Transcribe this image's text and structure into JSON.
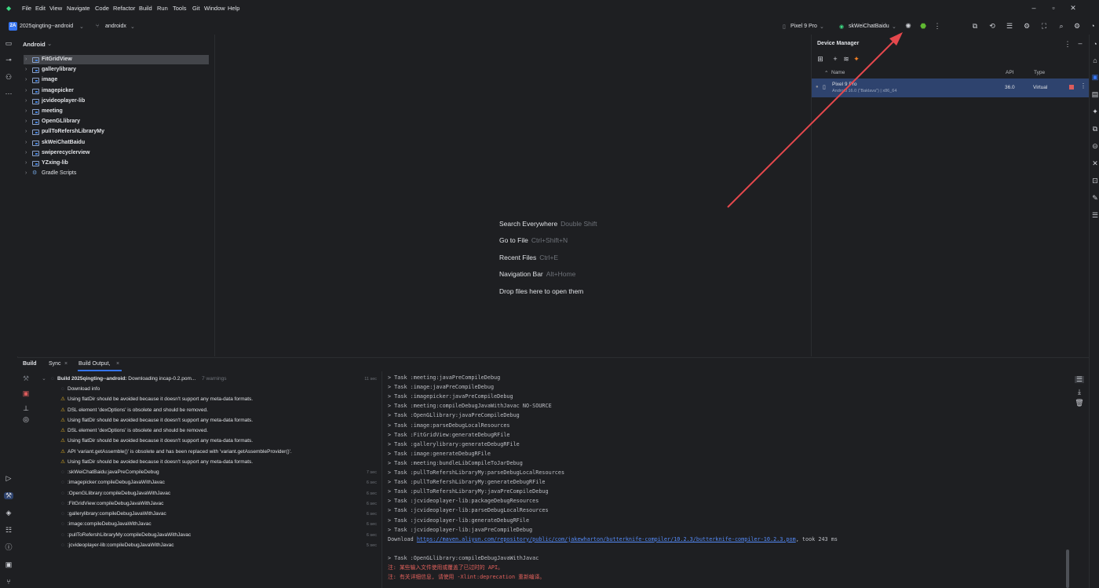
{
  "menu": [
    "File",
    "Edit",
    "View",
    "Navigate",
    "Code",
    "Refactor",
    "Build",
    "Run",
    "Tools",
    "Git",
    "Window",
    "Help"
  ],
  "toolbar": {
    "project_badge": "2A",
    "project_name": "2025qingting--android",
    "branch": "androidx",
    "device": "Pixel 9 Pro",
    "run_config": "skWeiChatBaidu"
  },
  "project_panel": {
    "title": "Android",
    "items": [
      {
        "label": "FitGridView",
        "selected": true
      },
      {
        "label": "gallerylibrary"
      },
      {
        "label": "image"
      },
      {
        "label": "imagepicker"
      },
      {
        "label": "jcvideoplayer-lib"
      },
      {
        "label": "meeting"
      },
      {
        "label": "OpenGLlibrary"
      },
      {
        "label": "pullToRefershLibraryMy"
      },
      {
        "label": "skWeiChatBaidu"
      },
      {
        "label": "swiperecyclerview"
      },
      {
        "label": "YZxing-lib"
      },
      {
        "label": "Gradle Scripts",
        "plain": true
      }
    ]
  },
  "editor_hints": [
    {
      "text": "Search Everywhere",
      "key": "Double Shift"
    },
    {
      "text": "Go to File",
      "key": "Ctrl+Shift+N"
    },
    {
      "text": "Recent Files",
      "key": "Ctrl+E"
    },
    {
      "text": "Navigation Bar",
      "key": "Alt+Home"
    },
    {
      "text": "Drop files here to open them",
      "key": ""
    }
  ],
  "device_manager": {
    "title": "Device Manager",
    "columns": {
      "name": "Name",
      "api": "API",
      "type": "Type"
    },
    "device": {
      "name": "Pixel 9 Pro",
      "subtitle": "Android 16.0 (\"Baklava\") | x86_64",
      "api": "36.0",
      "type": "Virtual"
    }
  },
  "build_panel": {
    "tabs": [
      "Build",
      "Sync",
      "Build Output"
    ],
    "root": {
      "label": "Build 2025qingting--android:",
      "detail": "Downloading incap-0.2.pom...",
      "warnings": "7 warnings",
      "time": "11 sec"
    },
    "rows": [
      {
        "icon": "spinner",
        "text": "Download info",
        "time": ""
      },
      {
        "icon": "warning",
        "text": "Using flatDir should be avoided because it doesn't support any meta-data formats.",
        "time": ""
      },
      {
        "icon": "warning",
        "text": "DSL element 'dexOptions' is obsolete and should be removed.",
        "time": ""
      },
      {
        "icon": "warning",
        "text": "Using flatDir should be avoided because it doesn't support any meta-data formats.",
        "time": ""
      },
      {
        "icon": "warning",
        "text": "DSL element 'dexOptions' is obsolete and should be removed.",
        "time": ""
      },
      {
        "icon": "warning",
        "text": "Using flatDir should be avoided because it doesn't support any meta-data formats.",
        "time": ""
      },
      {
        "icon": "warning",
        "text": "API 'variant.getAssemble()' is obsolete and has been replaced with 'variant.getAssembleProvider()'.",
        "time": ""
      },
      {
        "icon": "warning",
        "text": "Using flatDir should be avoided because it doesn't support any meta-data formats.",
        "time": ""
      },
      {
        "icon": "spinner",
        "text": ":skWeiChatBaidu:javaPreCompileDebug",
        "time": "7 sec"
      },
      {
        "icon": "spinner",
        "text": ":imagepicker:compileDebugJavaWithJavac",
        "time": "6 sec"
      },
      {
        "icon": "spinner",
        "text": ":OpenGLlibrary:compileDebugJavaWithJavac",
        "time": "6 sec"
      },
      {
        "icon": "spinner",
        "text": ":FitGridView:compileDebugJavaWithJavac",
        "time": "6 sec"
      },
      {
        "icon": "spinner",
        "text": ":gallerylibrary:compileDebugJavaWithJavac",
        "time": "6 sec"
      },
      {
        "icon": "spinner",
        "text": ":image:compileDebugJavaWithJavac",
        "time": "6 sec"
      },
      {
        "icon": "spinner",
        "text": ":pullToRefershLibraryMy:compileDebugJavaWithJavac",
        "time": "6 sec"
      },
      {
        "icon": "spinner",
        "text": ":jcvideoplayer-lib:compileDebugJavaWithJavac",
        "time": "5 sec"
      }
    ]
  },
  "build_output": {
    "lines": [
      "> Task :meeting:javaPreCompileDebug",
      "> Task :image:javaPreCompileDebug",
      "> Task :imagepicker:javaPreCompileDebug",
      "> Task :meeting:compileDebugJavaWithJavac NO-SOURCE",
      "> Task :OpenGLlibrary:javaPreCompileDebug",
      "> Task :image:parseDebugLocalResources",
      "> Task :FitGridView:generateDebugRFile",
      "> Task :gallerylibrary:generateDebugRFile",
      "> Task :image:generateDebugRFile",
      "> Task :meeting:bundleLibCompileToJarDebug",
      "> Task :pullToRefershLibraryMy:parseDebugLocalResources",
      "> Task :pullToRefershLibraryMy:generateDebugRFile",
      "> Task :pullToRefershLibraryMy:javaPreCompileDebug",
      "> Task :jcvideoplayer-lib:packageDebugResources",
      "> Task :jcvideoplayer-lib:parseDebugLocalResources",
      "> Task :jcvideoplayer-lib:generateDebugRFile",
      "> Task :jcvideoplayer-lib:javaPreCompileDebug"
    ],
    "download_prefix": "Download ",
    "download_url": "https://maven.aliyun.com/repository/public/com/jakewharton/butterknife-compiler/10.2.3/butterknife-compiler-10.2.3.pom",
    "download_suffix": ", took 243 ms",
    "task_line": "> Task :OpenGLlibrary:compileDebugJavaWithJavac",
    "errors": [
      "注: 某些输入文件使用或覆盖了已过时的 API。",
      "注: 有关详细信息, 请使用 -Xlint:deprecation 重新编译。"
    ]
  },
  "colors": {
    "accent": "#3574f0",
    "selection": "#2e436e",
    "warning": "#e6b422",
    "arrow": "#e5484d"
  }
}
